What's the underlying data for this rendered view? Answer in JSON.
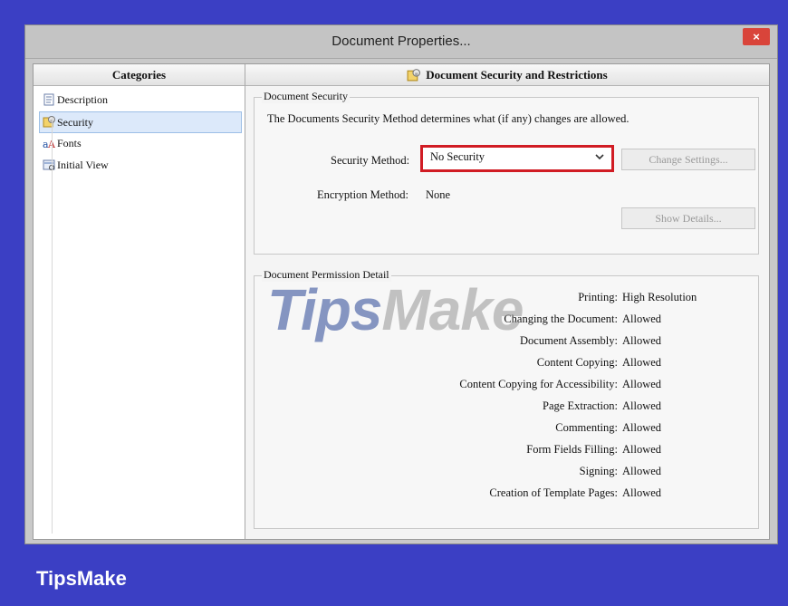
{
  "window": {
    "title": "Document Properties...",
    "close_label": "×"
  },
  "categories": {
    "header": "Categories",
    "items": [
      {
        "label": "Description",
        "icon": "description-icon",
        "selected": false
      },
      {
        "label": "Security",
        "icon": "security-icon",
        "selected": true
      },
      {
        "label": "Fonts",
        "icon": "fonts-icon",
        "selected": false
      },
      {
        "label": "Initial View",
        "icon": "initial-view-icon",
        "selected": false
      }
    ]
  },
  "main": {
    "header": "Document Security and Restrictions",
    "security_group": {
      "legend": "Document Security",
      "description": "The Documents Security Method determines what (if any) changes are allowed.",
      "method_label": "Security Method:",
      "method_value": "No Security",
      "change_settings": "Change Settings...",
      "encryption_label": "Encryption Method:",
      "encryption_value": "None",
      "show_details": "Show Details..."
    },
    "permission_group": {
      "legend": "Document Permission Detail",
      "rows": [
        {
          "label": "Printing:",
          "value": "High Resolution"
        },
        {
          "label": "Changing the Document:",
          "value": "Allowed"
        },
        {
          "label": "Document Assembly:",
          "value": "Allowed"
        },
        {
          "label": "Content Copying:",
          "value": "Allowed"
        },
        {
          "label": "Content Copying for Accessibility:",
          "value": "Allowed"
        },
        {
          "label": "Page Extraction:",
          "value": "Allowed"
        },
        {
          "label": "Commenting:",
          "value": "Allowed"
        },
        {
          "label": "Form Fields Filling:",
          "value": "Allowed"
        },
        {
          "label": "Signing:",
          "value": "Allowed"
        },
        {
          "label": "Creation of Template Pages:",
          "value": "Allowed"
        }
      ]
    }
  },
  "watermark": {
    "part1": "Tips",
    "part2": "Make"
  },
  "brand": "TipsMake",
  "colors": {
    "background": "#3b3fc4",
    "highlight_border": "#d11c24",
    "close_button": "#d9443a",
    "selection": "#dce9fa"
  }
}
